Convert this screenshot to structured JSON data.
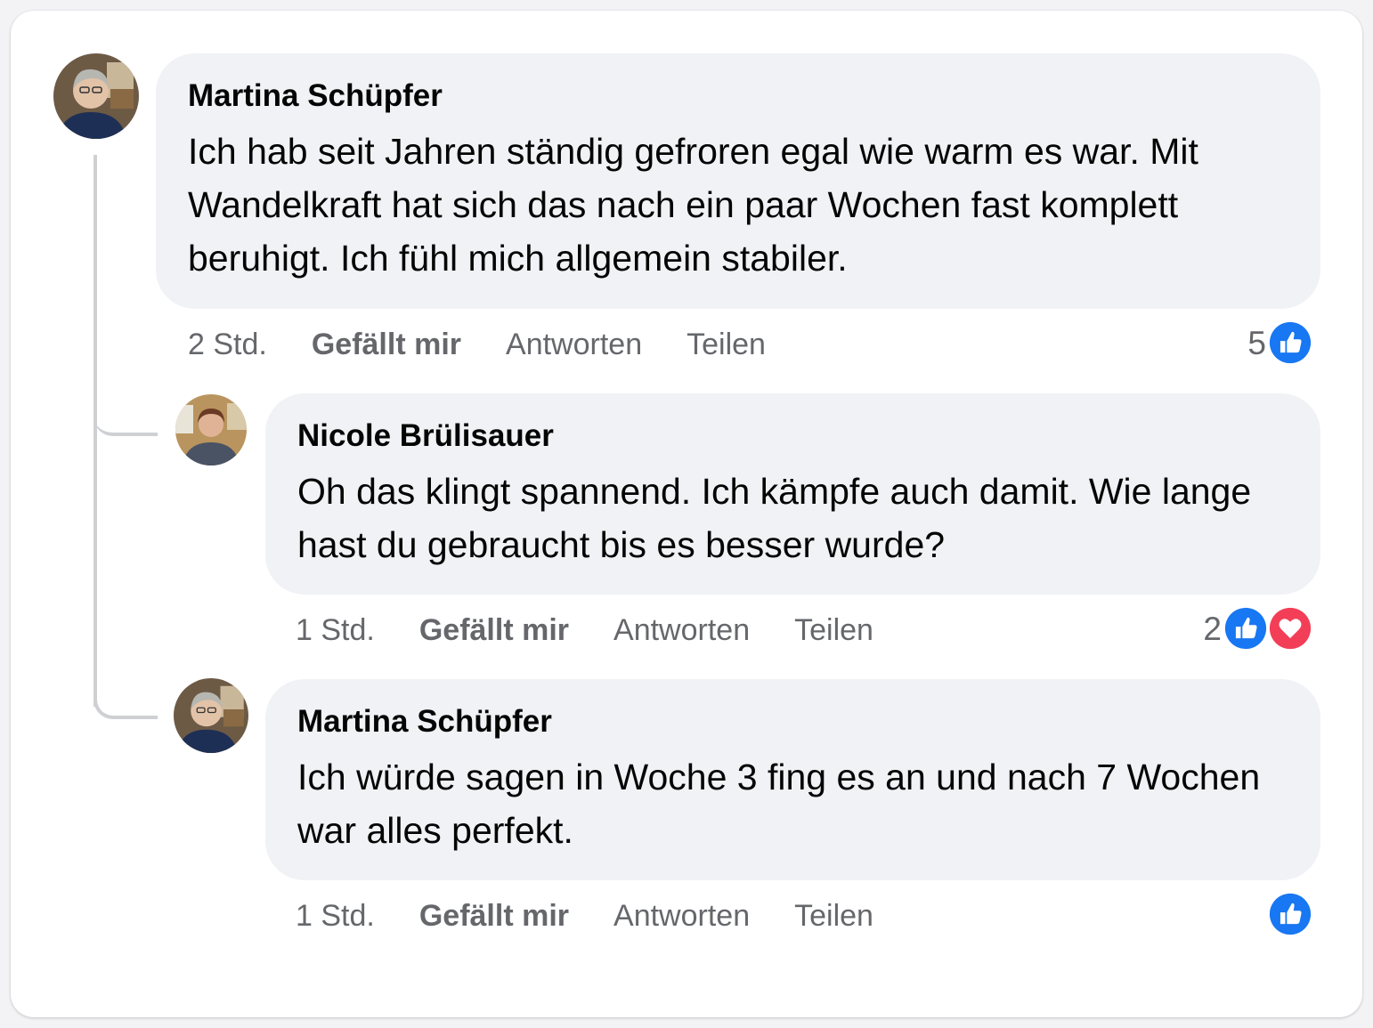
{
  "comments": [
    {
      "author": "Martina Schüpfer",
      "text": "Ich hab seit Jahren ständig gefroren egal wie warm es war. Mit Wandelkraft hat sich das nach ein paar Wochen fast komplett beruhigt. Ich fühl mich allgemein stabiler.",
      "time": "2 Std.",
      "like_label": "Gefällt mir",
      "reply_label": "Antworten",
      "share_label": "Teilen",
      "reaction_count": "5",
      "reactions": [
        "like-icon"
      ]
    },
    {
      "author": "Nicole Brülisauer",
      "text": "Oh das klingt spannend. Ich kämpfe auch damit. Wie lange hast du gebraucht bis es besser wurde?",
      "time": "1 Std.",
      "like_label": "Gefällt mir",
      "reply_label": "Antworten",
      "share_label": "Teilen",
      "reaction_count": "2",
      "reactions": [
        "like-icon",
        "love-icon"
      ]
    },
    {
      "author": "Martina Schüpfer",
      "text": "Ich würde sagen in Woche 3 fing es an und nach 7 Wochen war alles perfekt.",
      "time": "1 Std.",
      "like_label": "Gefällt mir",
      "reply_label": "Antworten",
      "share_label": "Teilen",
      "reaction_count": "",
      "reactions": [
        "like-icon"
      ]
    }
  ],
  "colors": {
    "bubble": "#f0f2f5",
    "meta_text": "#65676b",
    "like_blue": "#1877f2",
    "love_red": "#f33e58"
  }
}
